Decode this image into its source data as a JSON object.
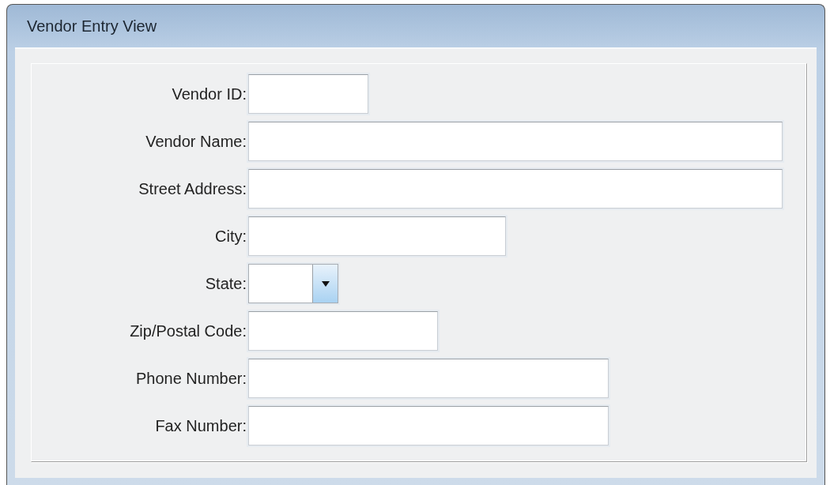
{
  "window": {
    "title": "Vendor Entry View"
  },
  "fields": [
    {
      "label": "Vendor ID:",
      "kind": "text"
    },
    {
      "label": "Vendor Name:",
      "kind": "text"
    },
    {
      "label": "Street Address:",
      "kind": "text"
    },
    {
      "label": "City:",
      "kind": "text"
    },
    {
      "label": "State:",
      "kind": "dropdown"
    },
    {
      "label": "Zip/Postal Code:",
      "kind": "text"
    },
    {
      "label": "Phone Number:",
      "kind": "text"
    },
    {
      "label": "Fax Number:",
      "kind": "text"
    }
  ]
}
